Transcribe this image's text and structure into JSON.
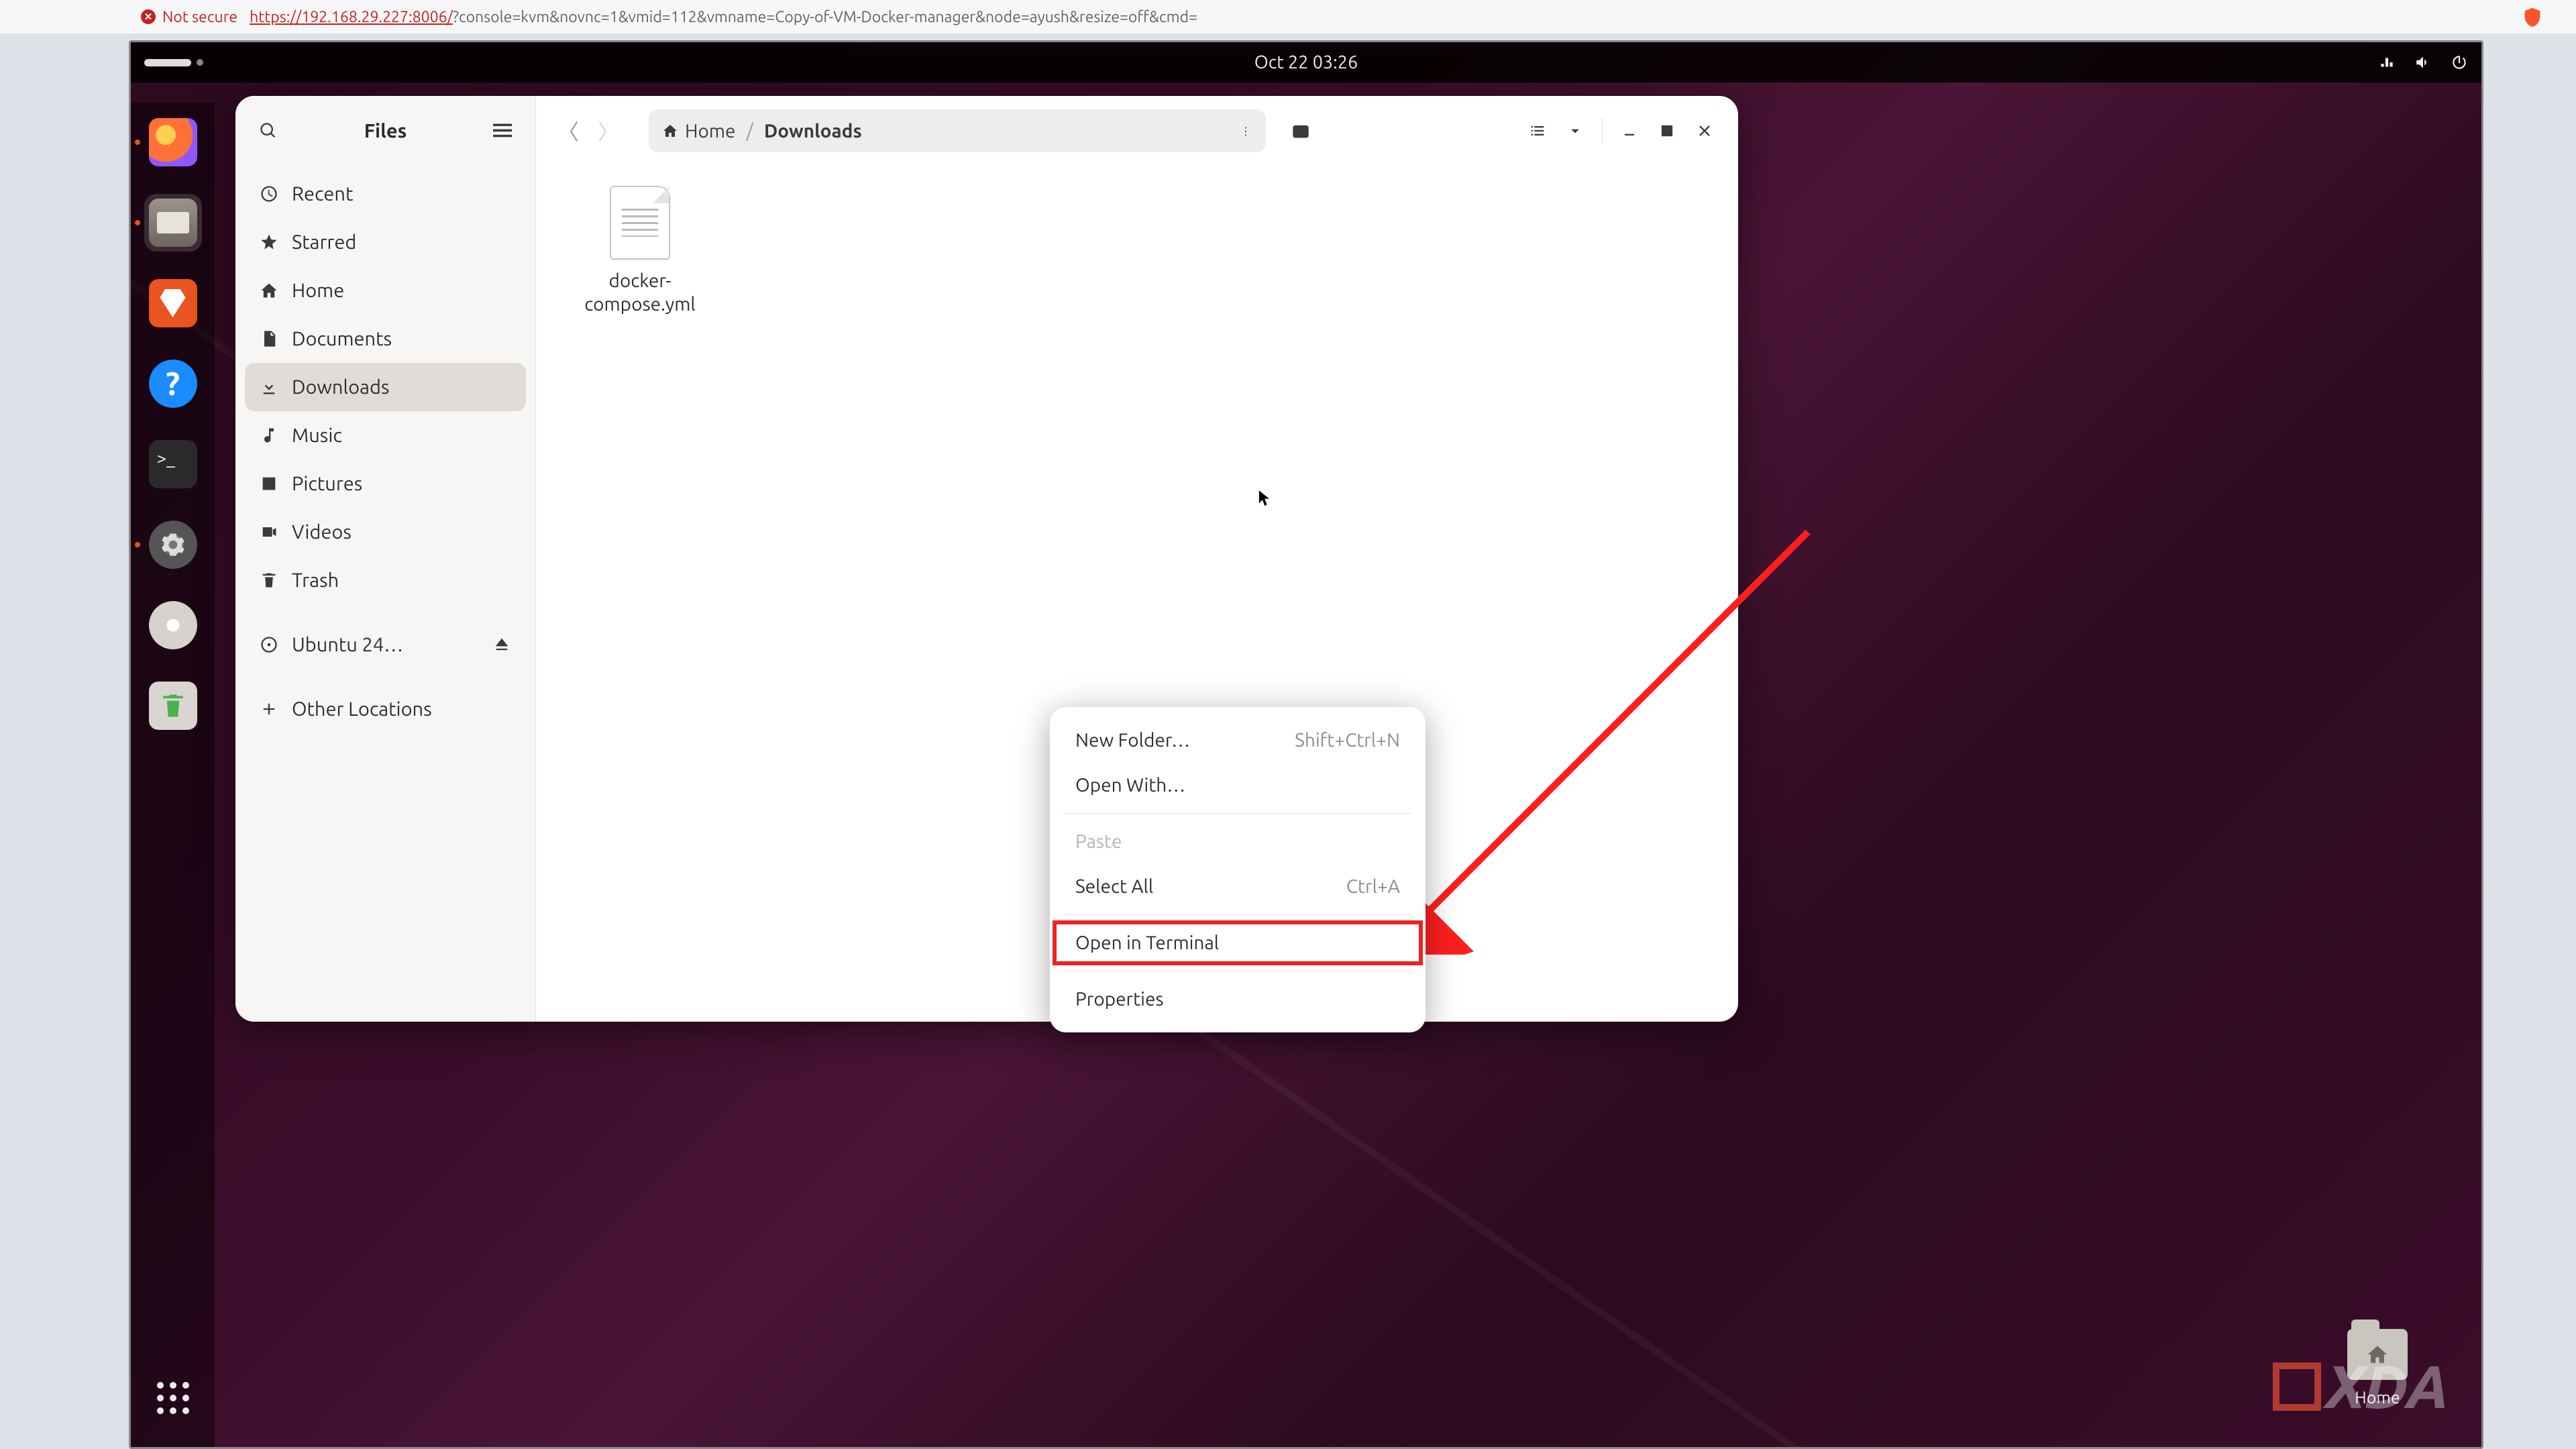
{
  "browser": {
    "not_secure_label": "Not secure",
    "url_prefix": "https://192.168.29.227:8006/",
    "url_params": "?console=kvm&novnc=1&vmid=112&vmname=Copy-of-VM-Docker-manager&node=ayush&resize=off&cmd="
  },
  "topbar": {
    "clock": "Oct 22  03:26"
  },
  "dock": {
    "items": [
      {
        "name": "firefox",
        "color": "#ff7139"
      },
      {
        "name": "files",
        "color": "#8d8479",
        "active": true
      },
      {
        "name": "software",
        "color": "#e95420"
      },
      {
        "name": "help",
        "color": "#2196f3"
      },
      {
        "name": "terminal",
        "color": "#2b2b2b"
      },
      {
        "name": "settings",
        "color": "#555"
      },
      {
        "name": "disc",
        "color": "#d9d6d1"
      },
      {
        "name": "trash",
        "color": "#d9d6d1"
      }
    ]
  },
  "sidebar": {
    "title": "Files",
    "items": [
      {
        "icon": "clock",
        "label": "Recent"
      },
      {
        "icon": "star",
        "label": "Starred"
      },
      {
        "icon": "home",
        "label": "Home"
      },
      {
        "icon": "doc",
        "label": "Documents"
      },
      {
        "icon": "download",
        "label": "Downloads",
        "selected": true
      },
      {
        "icon": "music",
        "label": "Music"
      },
      {
        "icon": "picture",
        "label": "Pictures"
      },
      {
        "icon": "video",
        "label": "Videos"
      },
      {
        "icon": "trash",
        "label": "Trash"
      },
      {
        "icon": "disc",
        "label": "Ubuntu 24…",
        "eject": true
      },
      {
        "icon": "plus",
        "label": "Other Locations"
      }
    ]
  },
  "breadcrumb": {
    "home": "Home",
    "current": "Downloads"
  },
  "files": [
    {
      "name": "docker-compose.yml"
    }
  ],
  "context_menu": {
    "new_folder": {
      "label": "New Folder…",
      "shortcut": "Shift+Ctrl+N"
    },
    "open_with": {
      "label": "Open With…"
    },
    "paste": {
      "label": "Paste"
    },
    "select_all": {
      "label": "Select All",
      "shortcut": "Ctrl+A"
    },
    "open_terminal": {
      "label": "Open in Terminal"
    },
    "properties": {
      "label": "Properties"
    }
  },
  "desktop": {
    "home_label": "Home"
  },
  "watermark": "XDA"
}
